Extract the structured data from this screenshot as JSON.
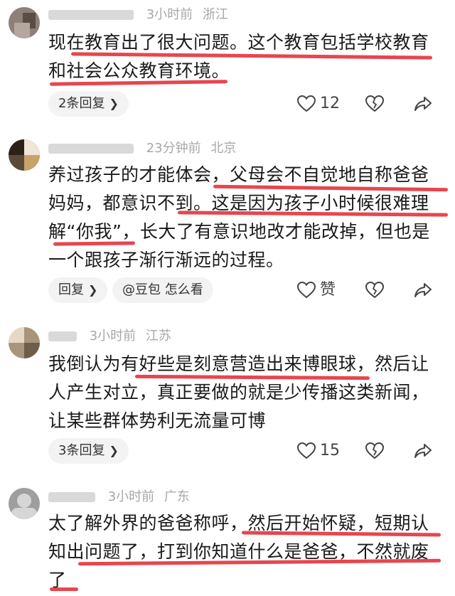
{
  "comments": [
    {
      "time": "3小时前",
      "location": "浙江",
      "lines": [
        "现在教育出了很大问题。这个教育包括学校教育",
        "和社会公众教育环境。"
      ],
      "replies_label": "2条回复",
      "like_count": "12"
    },
    {
      "time": "23分钟前",
      "location": "北京",
      "lines": [
        "养过孩子的才能体会，父母会不自觉地自称爸爸",
        "妈妈，都意识不到。这是因为孩子小时候很难理",
        "解“你我”，长大了有意识地改才能改掉，但也是",
        "一个跟孩子渐行渐远的过程。"
      ],
      "replies_label": "回复",
      "extra_label": "@豆包 怎么看",
      "like_count": "赞"
    },
    {
      "time": "3小时前",
      "location": "江苏",
      "lines": [
        "我倒认为有好些是刻意营造出来博眼球，然后让",
        "人产生对立，真正要做的就是少传播这类新闻，",
        "让某些群体势利无流量可博"
      ],
      "replies_label": "3条回复",
      "like_count": "15"
    },
    {
      "time": "3小时前",
      "location": "广东",
      "lines": [
        "太了解外界的爸爸称呼，然后开始怀疑，短期认",
        "知出问题了，打到你知道什么是爸爸，不然就废",
        "了"
      ]
    }
  ],
  "colors": {
    "annotation": "#e3262f",
    "meta": "#a7a7a7"
  }
}
